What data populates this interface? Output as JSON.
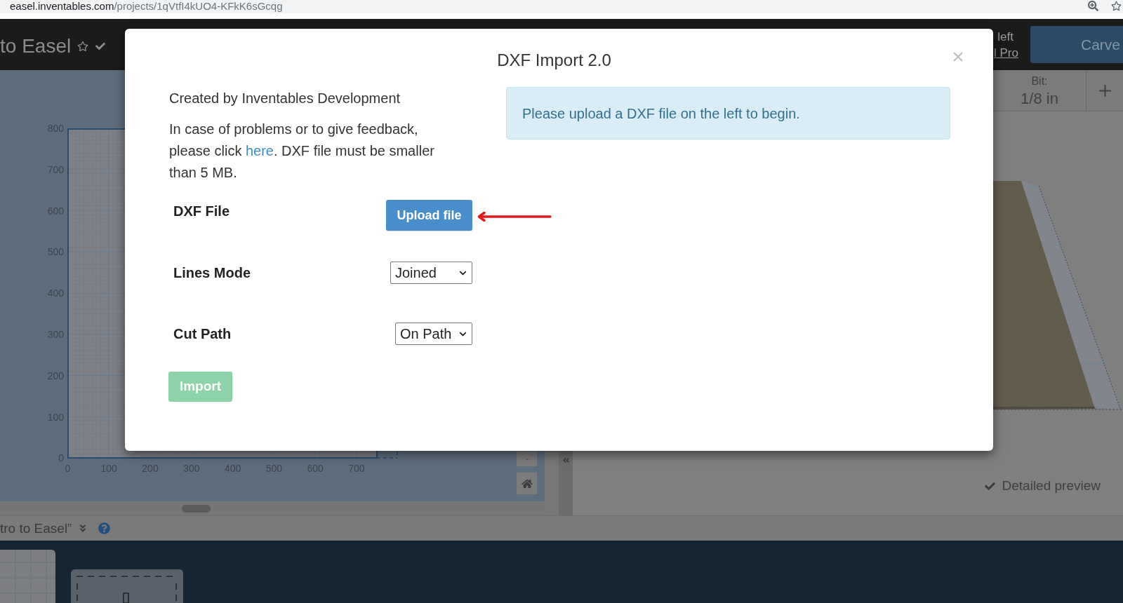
{
  "browser": {
    "url_domain": "easel.inventables.com",
    "url_path": "/projects/1qVtfI4kUO4-KFkK6sGcqg"
  },
  "header": {
    "project_title": "to Easel",
    "credits_text": "left",
    "upgrade_link": "l Pro",
    "carve_button": "Carve"
  },
  "design_canvas": {
    "y_labels": [
      "800",
      "700",
      "600",
      "500",
      "400",
      "300",
      "200",
      "100",
      "0"
    ],
    "x_labels": [
      "0",
      "100",
      "200",
      "300",
      "400",
      "500",
      "600",
      "700"
    ]
  },
  "bit_toolbar": {
    "label": "Bit:",
    "value": "1/8 in"
  },
  "preview": {
    "detailed_preview": {
      "label": "Detailed preview",
      "checked": true
    }
  },
  "bottom_bar": {
    "project_name": "tro to Easel”"
  },
  "modal": {
    "title": "DXF Import 2.0",
    "credit": "Created by Inventables Development",
    "help_text": {
      "before": "In case of problems or to give feedback, please click ",
      "link": "here",
      "after": ". DXF file must be smaller than 5 MB."
    },
    "fields": [
      {
        "kind": "upload",
        "label": "DXF File",
        "button": "Upload file"
      },
      {
        "kind": "select",
        "label": "Lines Mode",
        "value": "Joined"
      },
      {
        "kind": "select",
        "label": "Cut Path",
        "value": "On Path"
      }
    ],
    "import_button": {
      "label": "Import",
      "disabled": true
    },
    "alert": "Please upload a DXF file on the left to begin."
  }
}
